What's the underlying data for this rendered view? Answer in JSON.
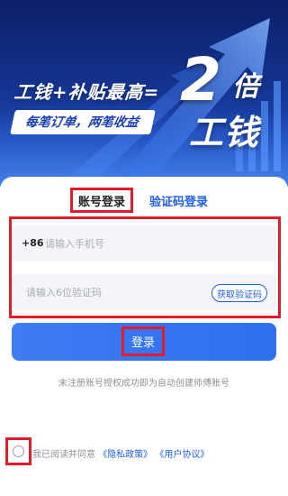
{
  "banner": {
    "headline": "工钱+补贴最高=",
    "pill": "每笔订单，两笔收益",
    "big_number": "2",
    "big_unit": "倍",
    "big_text": "工钱"
  },
  "tabs": {
    "account_login": "账号登录",
    "code_login": "验证码登录"
  },
  "form": {
    "phone_prefix": "+86",
    "phone_placeholder": "请输入手机号",
    "code_placeholder": "请输入6位验证码",
    "get_code_label": "获取验证码"
  },
  "login_button": "登录",
  "notice": "未注册账号授权成功即为自动创建师傅账号",
  "agreement": {
    "prefix": "我已阅读并同意",
    "privacy": "《隐私政策》",
    "user": "《用户协议》"
  },
  "colors": {
    "accent": "#1f5fe0",
    "button": "#3f7cf2",
    "highlight": "#e21d2b"
  }
}
